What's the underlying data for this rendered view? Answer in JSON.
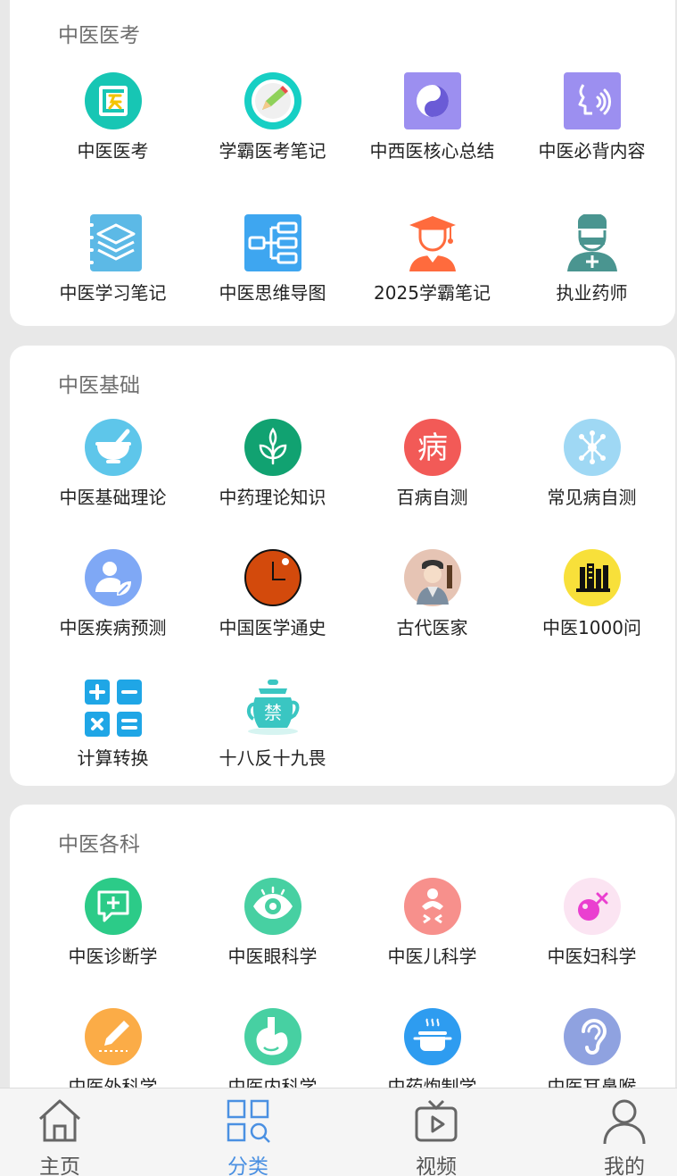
{
  "sections": [
    {
      "title": "中医医考",
      "items": [
        {
          "label": "中医医考",
          "icon": "yi-kao-icon"
        },
        {
          "label": "学霸医考笔记",
          "icon": "pencil-notes-icon"
        },
        {
          "label": "中西医核心总结",
          "icon": "yin-yang-icon"
        },
        {
          "label": "中医必背内容",
          "icon": "recite-voice-icon"
        },
        {
          "label": "中医学习笔记",
          "icon": "layers-notebook-icon"
        },
        {
          "label": "中医思维导图",
          "icon": "mind-map-icon"
        },
        {
          "label": "2025学霸笔记",
          "icon": "graduate-icon"
        },
        {
          "label": "执业药师",
          "icon": "pharmacist-icon"
        }
      ]
    },
    {
      "title": "中医基础",
      "items": [
        {
          "label": "中医基础理论",
          "icon": "mortar-pestle-icon"
        },
        {
          "label": "中药理论知识",
          "icon": "herb-leaf-icon"
        },
        {
          "label": "百病自测",
          "icon": "disease-char-icon",
          "glyph": "病"
        },
        {
          "label": "常见病自测",
          "icon": "molecule-icon"
        },
        {
          "label": "中医疾病预测",
          "icon": "person-leaf-icon"
        },
        {
          "label": "中国医学通史",
          "icon": "clock-history-icon"
        },
        {
          "label": "古代医家",
          "icon": "ancient-doctor-icon"
        },
        {
          "label": "中医1000问",
          "icon": "books-qa-icon"
        },
        {
          "label": "计算转换",
          "icon": "calculator-icon"
        },
        {
          "label": "十八反十九畏",
          "icon": "forbidden-teapot-icon",
          "glyph": "禁"
        }
      ]
    },
    {
      "title": "中医各科",
      "items": [
        {
          "label": "中医诊断学",
          "icon": "diagnosis-chat-icon"
        },
        {
          "label": "中医眼科学",
          "icon": "eye-icon"
        },
        {
          "label": "中医儿科学",
          "icon": "baby-icon"
        },
        {
          "label": "中医妇科学",
          "icon": "female-symbol-icon"
        },
        {
          "label": "中医外科学",
          "icon": "surgery-pen-icon"
        },
        {
          "label": "中医内科学",
          "icon": "stomach-icon"
        },
        {
          "label": "中药炮制学",
          "icon": "cooking-pot-icon"
        },
        {
          "label": "中医耳鼻喉",
          "icon": "ear-icon"
        }
      ]
    }
  ],
  "tabs": [
    {
      "label": "主页",
      "icon": "home-icon"
    },
    {
      "label": "分类",
      "icon": "category-grid-icon",
      "active": true
    },
    {
      "label": "视频",
      "icon": "video-tv-icon"
    },
    {
      "label": "我的",
      "icon": "user-profile-icon"
    }
  ],
  "colors": {
    "accent": "#4a90e2",
    "background": "#e8e8e8",
    "card": "#ffffff"
  }
}
